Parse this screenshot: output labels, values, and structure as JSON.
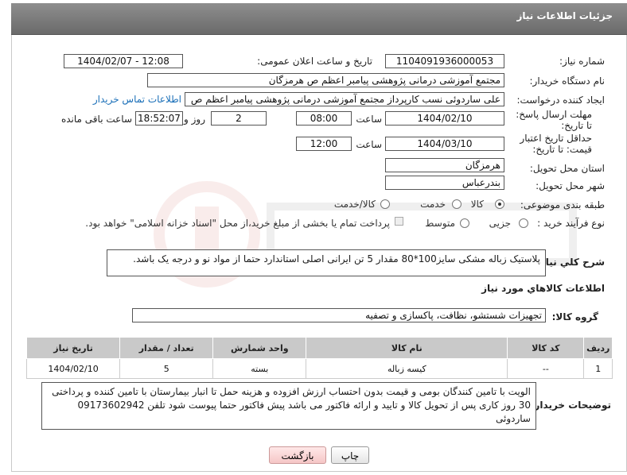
{
  "header": {
    "title": "جزئیات اطلاعات نیاز"
  },
  "fields": {
    "need_number_label": "شماره نیاز:",
    "need_number": "1104091936000053",
    "announce_label": "تاریخ و ساعت اعلان عمومی:",
    "announce_value": "1404/02/07 - 12:08",
    "buyer_org_label": "نام دستگاه خریدار:",
    "buyer_org": "مجتمع آموزشی درمانی پژوهشی پیامبر اعظم ص  هرمزگان",
    "creator_label": "ایجاد کننده درخواست:",
    "creator": "علی ساردوئی نسب کارپرداز مجتمع آموزشی درمانی پژوهشی پیامبر اعظم ص",
    "contact_link": "اطلاعات تماس خریدار",
    "reply_deadline_label": "مهلت ارسال پاسخ: تا تاریخ:",
    "reply_date": "1404/02/10",
    "time_word": "ساعت",
    "reply_time": "08:00",
    "days_value": "2",
    "days_word": "روز و",
    "remaining_time": "18:52:07",
    "remaining_word": "ساعت باقی مانده",
    "price_deadline_label": "حداقل تاریخ اعتبار قیمت: تا تاریخ:",
    "price_date": "1404/03/10",
    "price_time": "12:00",
    "province_label": "استان محل تحویل:",
    "province": "هرمزگان",
    "city_label": "شهر محل تحویل:",
    "city": "بندرعباس",
    "category_label": "طبقه بندی موضوعی:",
    "category_options": [
      "کالا",
      "خدمت",
      "کالا/خدمت"
    ],
    "purchase_type_label": "نوع فرآیند خرید :",
    "purchase_options": [
      "جزیی",
      "متوسط"
    ],
    "payment_note": "پرداخت تمام یا بخشی از مبلغ خرید،از محل \"اسناد خزانه اسلامی\" خواهد بود."
  },
  "description": {
    "label": "شرح كلي نياز:",
    "text": "پلاستیک زباله  مشکی  سایز100*80   مقدار  5 تن  ایرانی اصلی استاندارد حتما از مواد نو و درجه یک باشد."
  },
  "goods": {
    "section_title": "اطلاعات كالاهاي مورد نياز",
    "group_label": "گروه کالا:",
    "group_value": "تجهیزات شستشو، نظافت، پاکسازی و تصفیه",
    "columns": [
      "ردیف",
      "کد کالا",
      "نام کالا",
      "واحد شمارش",
      "تعداد / مقدار",
      "تاریخ نیاز"
    ],
    "rows": [
      {
        "index": "1",
        "code": "--",
        "name": "کیسه زباله",
        "unit": "بسته",
        "qty": "5",
        "date": "1404/02/10"
      }
    ]
  },
  "buyer_notes": {
    "label": "توضیحات خریدار:",
    "text": "الویت با تامین کنندگان بومی و قیمت بدون احتساب ارزش افزوده و هزینه حمل تا انبار بیمارستان با تامین کننده و پرداختی 30 روز کاری پس از تحویل کالا و تایید و ارائه  فاکتور می باشد پیش فاکتور حتما پیوست شود تلفن 09173602942 ساردوئی"
  },
  "buttons": {
    "print": "چاپ",
    "back": "بازگشت"
  },
  "colors": {
    "header": "#7a7a7a",
    "link": "#1a6fb8",
    "table_header": "#c9c9c9",
    "back_button": "#f5c6c6"
  }
}
